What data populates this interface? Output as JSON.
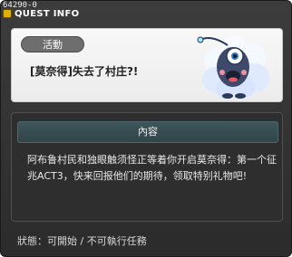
{
  "window": {
    "id_label": "64290-0",
    "title": "QUEST INFO"
  },
  "quest": {
    "category_label": "活動",
    "title": "[莫奈得]失去了村庄?!"
  },
  "content": {
    "header": "內容",
    "body": "阿布鲁村民和独眼触须怪正等着你开启莫奈得：第一个征兆ACT3，快来回报他们的期待，领取特别礼物吧!"
  },
  "status": {
    "text": "狀態：可開始 / 不可執行任務"
  },
  "icons": {
    "quest": "quest-icon",
    "creature": "creature-illustration",
    "close": "close-icon"
  },
  "colors": {
    "panel_bg": "#f2f2f2",
    "window_bg": "#2b2b2b",
    "header_bg": "#3d555b"
  }
}
